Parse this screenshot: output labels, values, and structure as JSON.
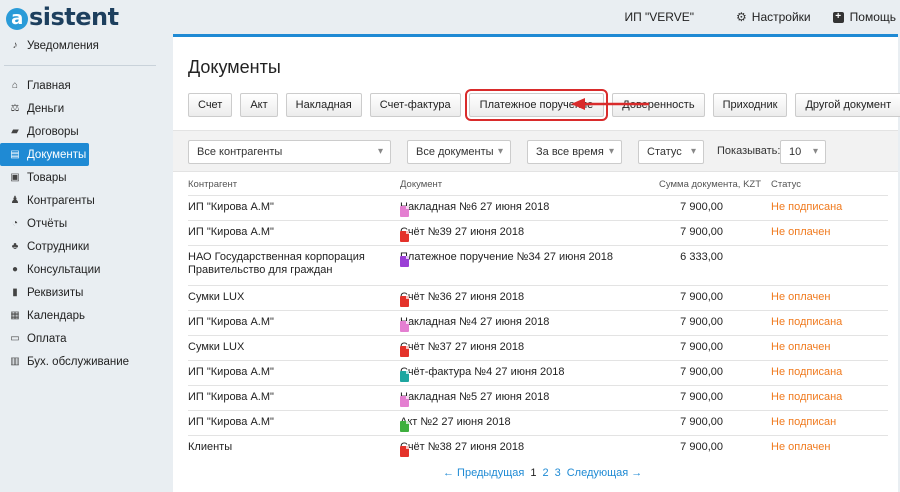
{
  "logo": {
    "text": "sistent",
    "badge": "a"
  },
  "header": {
    "org": "ИП \"VERVE\"",
    "settings_label": "Настройки",
    "help_label": "Помощь"
  },
  "sidebar": {
    "top_item": {
      "label": "Уведомления",
      "icon": "bell-icon"
    },
    "items": [
      {
        "label": "Главная",
        "icon": "home-icon",
        "glyph": "⌂"
      },
      {
        "label": "Деньги",
        "icon": "scales-icon",
        "glyph": "⚖"
      },
      {
        "label": "Договоры",
        "icon": "folder-icon",
        "glyph": "▰"
      },
      {
        "label": "Документы",
        "icon": "document-icon",
        "glyph": "▤",
        "active": true
      },
      {
        "label": "Товары",
        "icon": "box-icon",
        "glyph": "▣"
      },
      {
        "label": "Контрагенты",
        "icon": "users-icon",
        "glyph": "♟"
      },
      {
        "label": "Отчёты",
        "icon": "chart-icon",
        "glyph": "◔"
      },
      {
        "label": "Сотрудники",
        "icon": "group-icon",
        "glyph": "♣"
      },
      {
        "label": "Консультации",
        "icon": "question-icon",
        "glyph": "●"
      },
      {
        "label": "Реквизиты",
        "icon": "book-icon",
        "glyph": "▮"
      },
      {
        "label": "Календарь",
        "icon": "calendar-icon",
        "glyph": "▦"
      },
      {
        "label": "Оплата",
        "icon": "money-icon",
        "glyph": "▭"
      },
      {
        "label": "Бух. обслуживание",
        "icon": "bank-icon",
        "glyph": "▥"
      }
    ]
  },
  "main": {
    "title": "Документы",
    "buttons": [
      {
        "label": "Счет"
      },
      {
        "label": "Акт"
      },
      {
        "label": "Накладная"
      },
      {
        "label": "Счет-фактура"
      },
      {
        "label": "Платежное поручение",
        "highlighted": true
      },
      {
        "label": "Доверенность"
      },
      {
        "label": "Приходник"
      },
      {
        "label": "Другой документ"
      }
    ],
    "filters": {
      "counterparty": "Все контрагенты",
      "documents": "Все документы",
      "period": "За все время",
      "status": "Статус",
      "show_label": "Показывать:",
      "show_value": "10"
    },
    "columns": {
      "party": "Контрагент",
      "doc": "Документ",
      "sum": "Сумма документа, KZT",
      "status": "Статус"
    },
    "rows": [
      {
        "party": "ИП \"Кирова А.М\"",
        "doc": "Накладная №6 27 июня 2018",
        "icon_color": "#e47fd1",
        "sum": "7 900,00",
        "status": "Не подписана"
      },
      {
        "party": "ИП \"Кирова А.М\"",
        "doc": "Счёт №39 27 июня 2018",
        "icon_color": "#e4322a",
        "sum": "7 900,00",
        "status": "Не оплачен"
      },
      {
        "party": "НАО Государственная корпорация Правительство для граждан",
        "doc": "Платежное поручение №34 27 июня 2018",
        "icon_color": "#9b3fd6",
        "sum": "6 333,00",
        "status": ""
      },
      {
        "party": "Сумки LUX",
        "doc": "Счёт №36 27 июня 2018",
        "icon_color": "#e4322a",
        "sum": "7 900,00",
        "status": "Не оплачен"
      },
      {
        "party": "ИП \"Кирова А.М\"",
        "doc": "Накладная №4 27 июня 2018",
        "icon_color": "#e47fd1",
        "sum": "7 900,00",
        "status": "Не подписана"
      },
      {
        "party": "Сумки LUX",
        "doc": "Счёт №37 27 июня 2018",
        "icon_color": "#e4322a",
        "sum": "7 900,00",
        "status": "Не оплачен"
      },
      {
        "party": "ИП \"Кирова А.М\"",
        "doc": "Счёт-фактура №4 27 июня 2018",
        "icon_color": "#1ea6a0",
        "sum": "7 900,00",
        "status": "Не подписана"
      },
      {
        "party": "ИП \"Кирова А.М\"",
        "doc": "Накладная №5 27 июня 2018",
        "icon_color": "#e47fd1",
        "sum": "7 900,00",
        "status": "Не подписана"
      },
      {
        "party": "ИП \"Кирова А.М\"",
        "doc": "Акт №2 27 июня 2018",
        "icon_color": "#3eaf3e",
        "sum": "7 900,00",
        "status": "Не подписан"
      },
      {
        "party": "Клиенты",
        "doc": "Счёт №38 27 июня 2018",
        "icon_color": "#e4322a",
        "sum": "7 900,00",
        "status": "Не оплачен"
      }
    ],
    "pager": {
      "prev": "← Предыдущая",
      "pages": [
        "1",
        "2",
        "3"
      ],
      "next": "Следующая →"
    }
  }
}
